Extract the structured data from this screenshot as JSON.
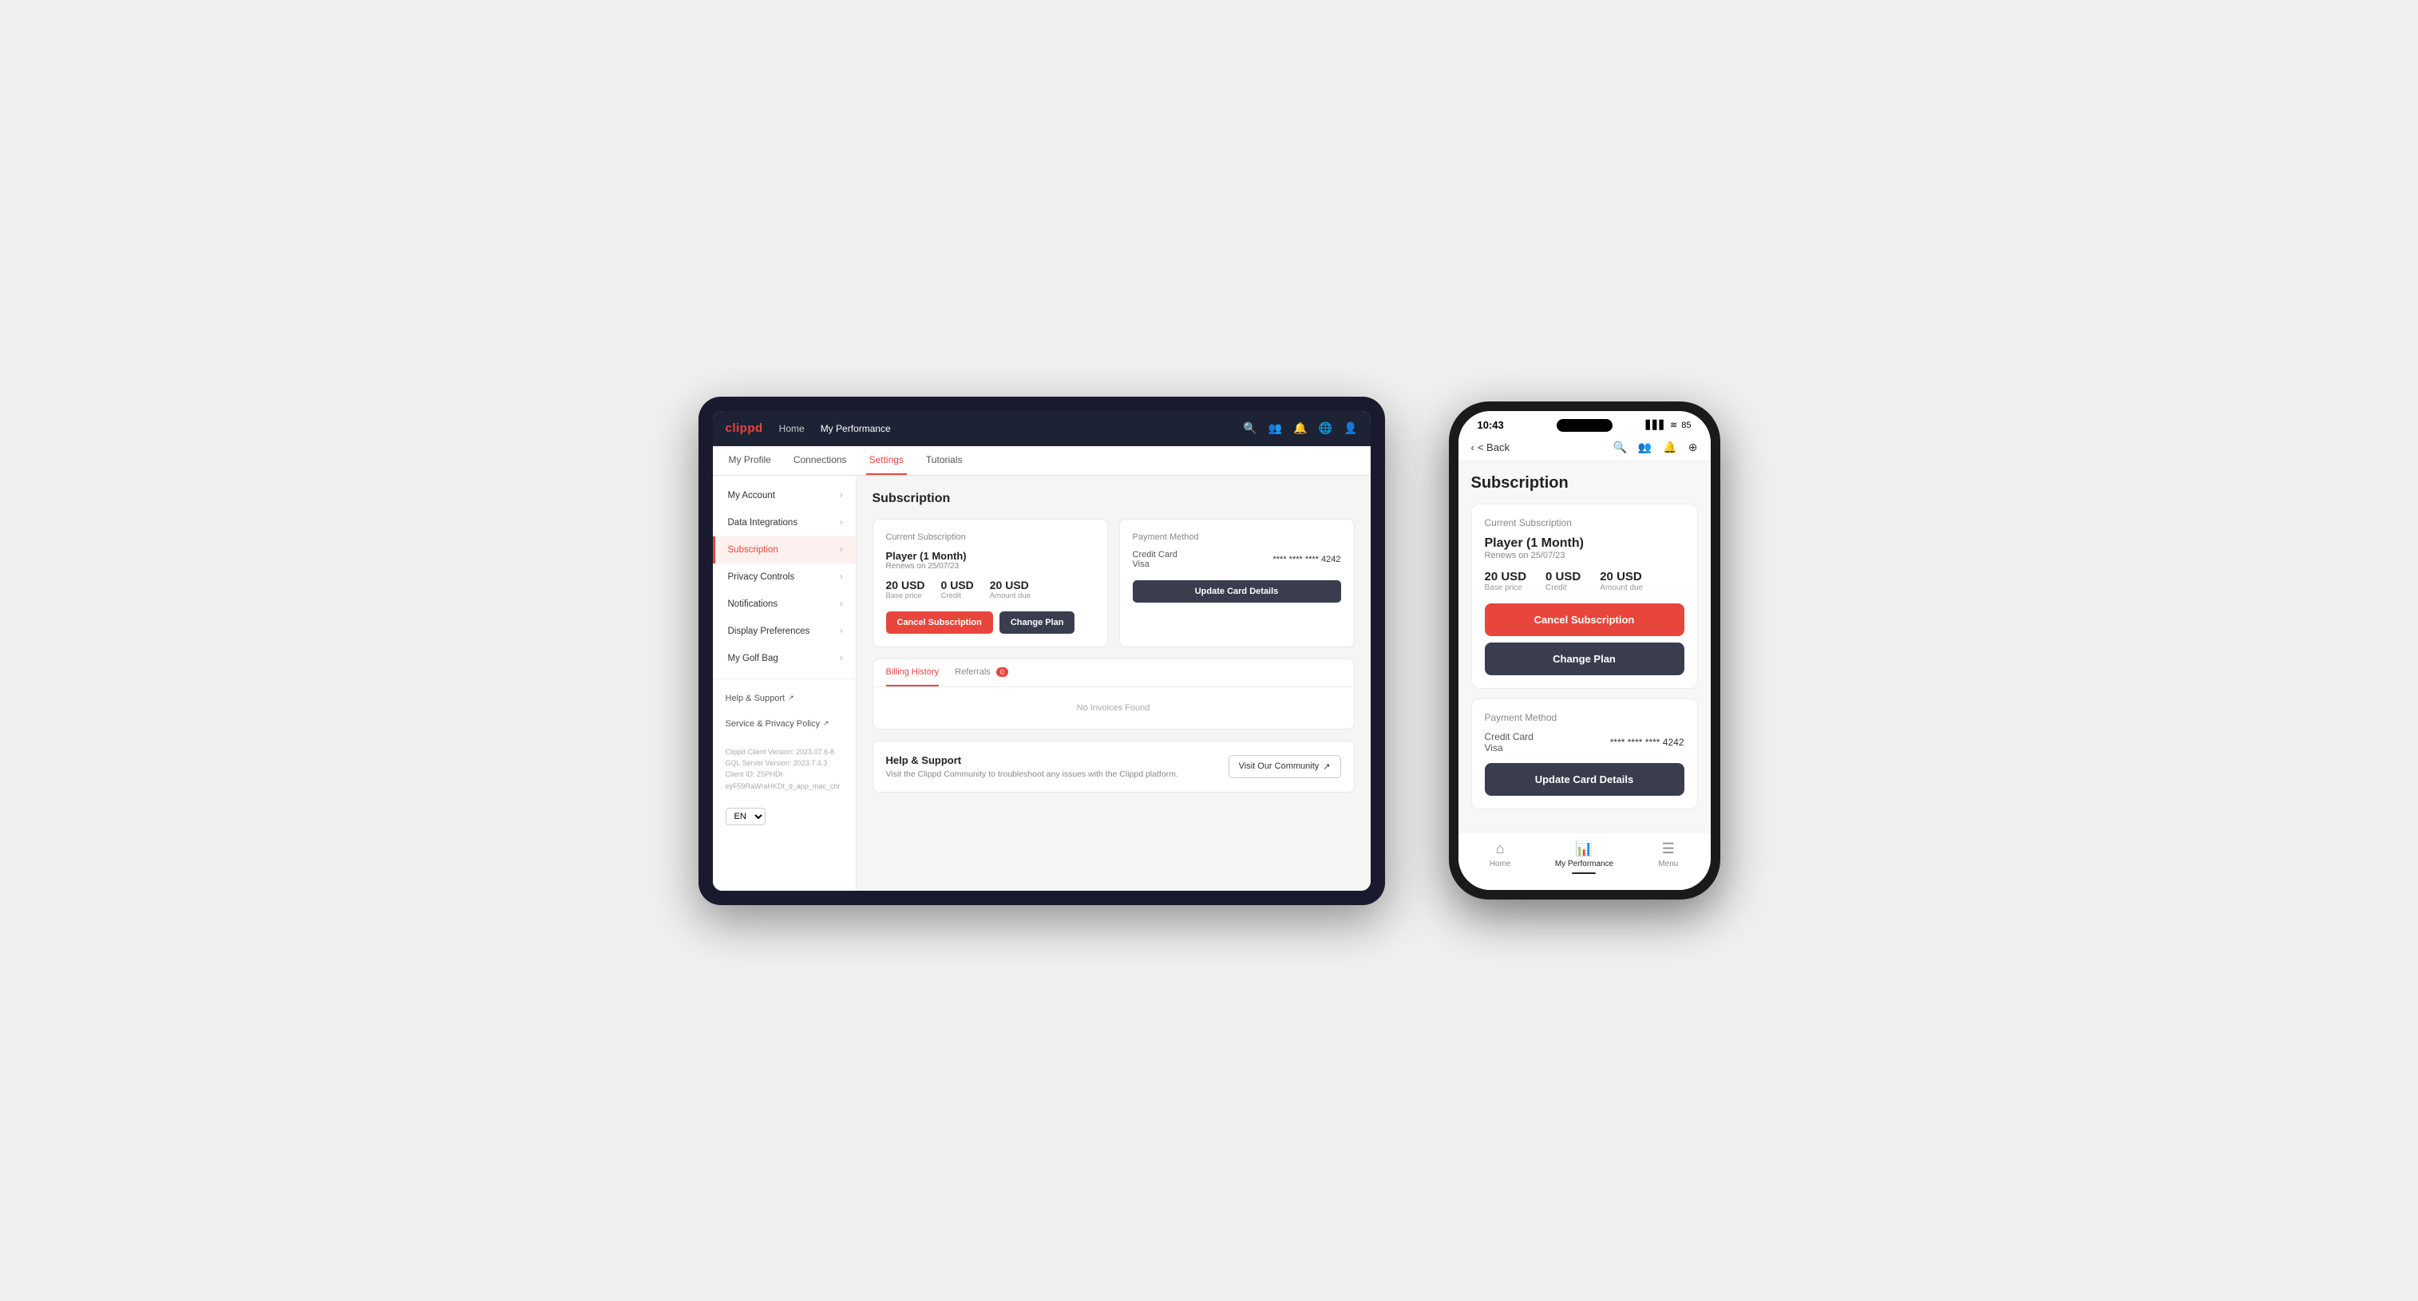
{
  "tablet": {
    "nav": {
      "logo": "clippd",
      "links": [
        "Home",
        "My Performance"
      ],
      "activeLink": "My Performance"
    },
    "subnav": {
      "items": [
        "My Profile",
        "Connections",
        "Settings",
        "Tutorials"
      ],
      "activeItem": "Settings"
    },
    "sidebar": {
      "items": [
        {
          "label": "My Account",
          "active": false
        },
        {
          "label": "Data Integrations",
          "active": false
        },
        {
          "label": "Subscription",
          "active": true
        },
        {
          "label": "Privacy Controls",
          "active": false
        },
        {
          "label": "Notifications",
          "active": false
        },
        {
          "label": "Display Preferences",
          "active": false
        },
        {
          "label": "My Golf Bag",
          "active": false
        }
      ],
      "links": [
        {
          "label": "Help & Support",
          "external": true
        },
        {
          "label": "Service & Privacy Policy",
          "external": true
        }
      ],
      "footer": {
        "client_version": "Clippd Client Version: 2023.07.6-8",
        "sql_version": "GQL Server Version: 2023.7.4.3",
        "client_id": "Client ID: Z5PHDt-eyF59RaWraHKDt_d_app_mac_chr"
      },
      "lang": "EN"
    },
    "main": {
      "pageTitle": "Subscription",
      "currentSubscription": {
        "label": "Current Subscription",
        "planName": "Player (1 Month)",
        "renews": "Renews on 25/07/23",
        "basePrice": "20 USD",
        "basePriceLabel": "Base price",
        "credit": "0 USD",
        "creditLabel": "Credit",
        "amountDue": "20 USD",
        "amountDueLabel": "Amount due",
        "cancelBtn": "Cancel Subscription",
        "changePlanBtn": "Change Plan"
      },
      "paymentMethod": {
        "label": "Payment Method",
        "cardType": "Credit Card",
        "cardBrand": "Visa",
        "cardNumber": "**** **** **** 4242",
        "updateBtn": "Update Card Details"
      },
      "billing": {
        "tabs": [
          {
            "label": "Billing History",
            "active": true
          },
          {
            "label": "Referrals",
            "active": false,
            "badge": "0"
          }
        ],
        "noInvoices": "No Invoices Found"
      },
      "helpSupport": {
        "title": "Help & Support",
        "description": "Visit the Clippd Community to troubleshoot any issues with the Clippd platform.",
        "communityBtn": "Visit Our Community"
      }
    }
  },
  "phone": {
    "statusBar": {
      "time": "10:43",
      "icons": "▋▋ ≋ 85"
    },
    "nav": {
      "backLabel": "< Back"
    },
    "pageTitle": "Subscription",
    "currentSubscription": {
      "label": "Current Subscription",
      "planName": "Player (1 Month)",
      "renews": "Renews on 25/07/23",
      "basePrice": "20 USD",
      "basePriceLabel": "Base price",
      "credit": "0 USD",
      "creditLabel": "Credit",
      "amountDue": "20 USD",
      "amountDueLabel": "Amount due",
      "cancelBtn": "Cancel Subscription",
      "changePlanBtn": "Change Plan"
    },
    "paymentMethod": {
      "label": "Payment Method",
      "cardType": "Credit Card",
      "cardBrand": "Visa",
      "cardNumber": "**** **** **** 4242",
      "updateBtn": "Update Card Details"
    },
    "bottomTabs": [
      {
        "label": "Home",
        "icon": "⌂",
        "active": false
      },
      {
        "label": "My Performance",
        "icon": "↗",
        "active": true
      },
      {
        "label": "Menu",
        "icon": "☰",
        "active": false
      }
    ]
  }
}
